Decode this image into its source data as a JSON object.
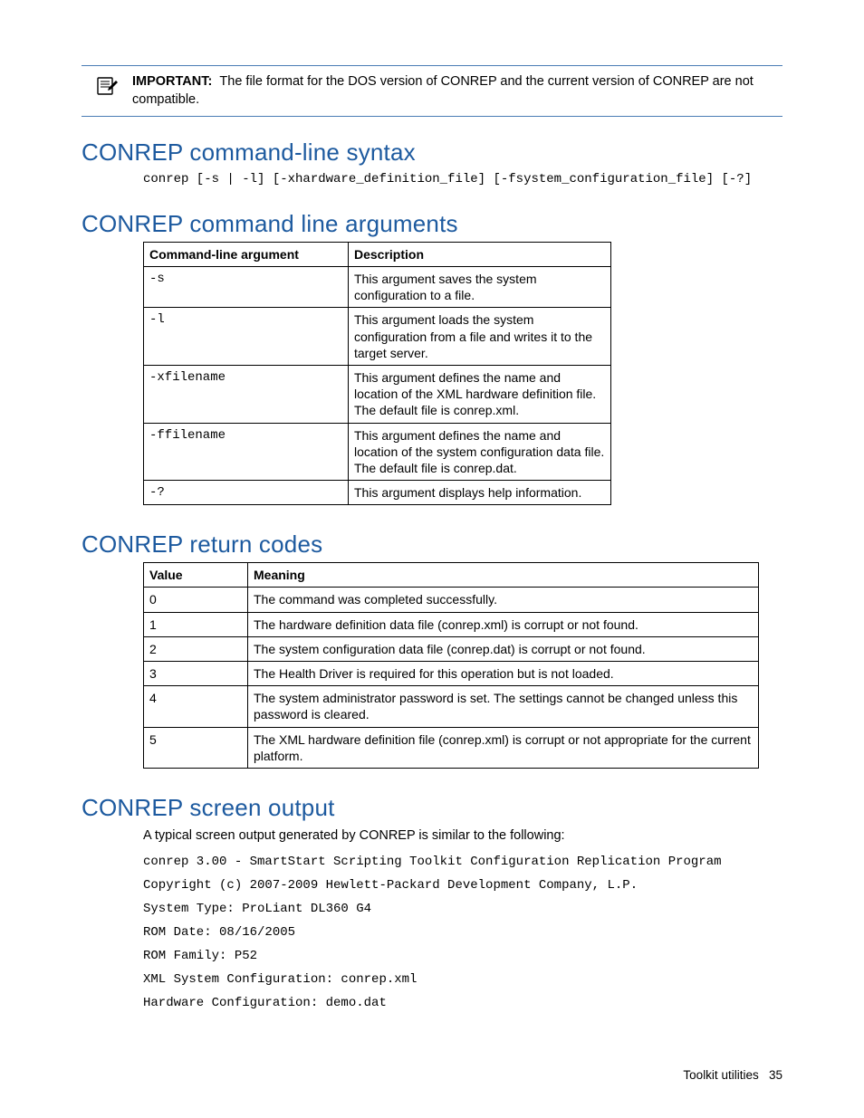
{
  "callout": {
    "label": "IMPORTANT:",
    "text": "The file format for the DOS version of CONREP and the current version of CONREP are not compatible."
  },
  "syntax": {
    "heading": "CONREP command-line syntax",
    "code": "conrep [-s | -l] [-xhardware_definition_file] [-fsystem_configuration_file] [-?]"
  },
  "args": {
    "heading": "CONREP command line arguments",
    "col1": "Command-line argument",
    "col2": "Description",
    "rows": [
      {
        "arg": "-s",
        "desc": "This argument saves the system configuration to a file."
      },
      {
        "arg": "-l",
        "desc": "This argument loads the system configuration from a file and writes it to the target server."
      },
      {
        "arg": "-xfilename",
        "desc": "This argument defines the name and location of the XML hardware definition file. The default file is conrep.xml."
      },
      {
        "arg": "-ffilename",
        "desc": "This argument defines the name and location of the system configuration data file. The default file is conrep.dat."
      },
      {
        "arg": "-?",
        "desc": "This argument displays help information."
      }
    ]
  },
  "codes": {
    "heading": "CONREP return codes",
    "col1": "Value",
    "col2": "Meaning",
    "rows": [
      {
        "v": "0",
        "m": "The command was completed successfully."
      },
      {
        "v": "1",
        "m": "The hardware definition data file (conrep.xml) is corrupt or not found."
      },
      {
        "v": "2",
        "m": "The system configuration data file (conrep.dat) is corrupt or not found."
      },
      {
        "v": "3",
        "m": "The Health Driver is required for this operation but is not loaded."
      },
      {
        "v": "4",
        "m": "The system administrator password is set. The settings cannot be changed unless this password is cleared."
      },
      {
        "v": "5",
        "m": "The XML hardware definition file (conrep.xml) is corrupt or not appropriate for the current platform."
      }
    ]
  },
  "output": {
    "heading": "CONREP screen output",
    "intro": "A typical screen output generated by CONREP is similar to the following:",
    "lines": [
      "conrep 3.00 - SmartStart Scripting Toolkit Configuration Replication Program",
      "Copyright (c) 2007-2009 Hewlett-Packard Development Company, L.P.",
      "System Type: ProLiant DL360 G4",
      "ROM Date: 08/16/2005",
      "ROM Family: P52",
      "XML System Configuration: conrep.xml",
      "Hardware Configuration: demo.dat"
    ]
  },
  "footer": {
    "section": "Toolkit utilities",
    "page": "35"
  }
}
